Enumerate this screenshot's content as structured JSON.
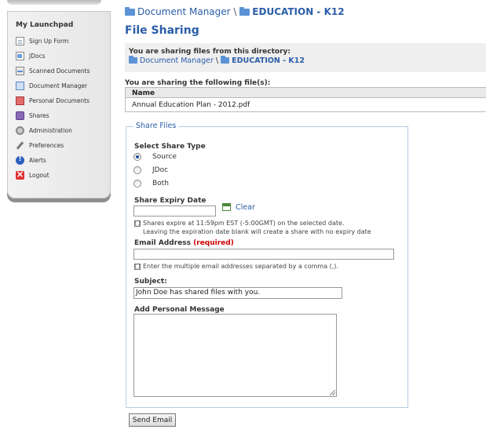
{
  "sidebar": {
    "title": "My Launchpad",
    "items": [
      {
        "label": "Sign Up Form",
        "icon": "document-icon"
      },
      {
        "label": "JDocs",
        "icon": "jdocs-icon"
      },
      {
        "label": "Scanned Documents",
        "icon": "scanner-icon"
      },
      {
        "label": "Document Manager",
        "icon": "document-manager-icon"
      },
      {
        "label": "Personal Documents",
        "icon": "personal-documents-icon"
      },
      {
        "label": "Shares",
        "icon": "shares-icon"
      },
      {
        "label": "Administration",
        "icon": "gear-icon"
      },
      {
        "label": "Preferences",
        "icon": "wrench-icon"
      },
      {
        "label": "Alerts",
        "icon": "alert-icon"
      },
      {
        "label": "Logout",
        "icon": "close-icon"
      }
    ]
  },
  "breadcrumb": {
    "root": "Document Manager",
    "separator": "\\",
    "current": "EDUCATION - K12"
  },
  "page_title": "File Sharing",
  "directory": {
    "label": "You are sharing files from this directory:",
    "root": "Document Manager",
    "separator": "\\",
    "current": "EDUCATION - K12"
  },
  "files": {
    "label": "You are sharing the following file(s):",
    "column_header": "Name",
    "rows": [
      "Annual Education Plan - 2012.pdf"
    ]
  },
  "share_form": {
    "legend": "Share Files",
    "share_type_label": "Select Share Type",
    "share_types": [
      {
        "label": "Source",
        "checked": true
      },
      {
        "label": "JDoc",
        "checked": false
      },
      {
        "label": "Both",
        "checked": false
      }
    ],
    "expiry_label": "Share Expiry Date",
    "expiry_value": "",
    "clear_label": "Clear",
    "info_glyph": "[.]",
    "expiry_note_line1": "Shares expire at 11:59pm EST (-5:00GMT) on the selected date.",
    "expiry_note_line2": "Leaving the expiration date blank will create a share with no expiry date",
    "email_label": "Email Address",
    "email_required": "(required)",
    "email_value": "",
    "email_note": "Enter the multiple email addresses separated by a comma (,).",
    "subject_label": "Subject:",
    "subject_value": "John Doe has shared files with you.",
    "message_label": "Add Personal Message",
    "message_value": "",
    "send_label": "Send Email"
  },
  "colors": {
    "link": "#2b5ea8",
    "required": "#cc0000",
    "fieldset_border": "#b8cce4"
  }
}
